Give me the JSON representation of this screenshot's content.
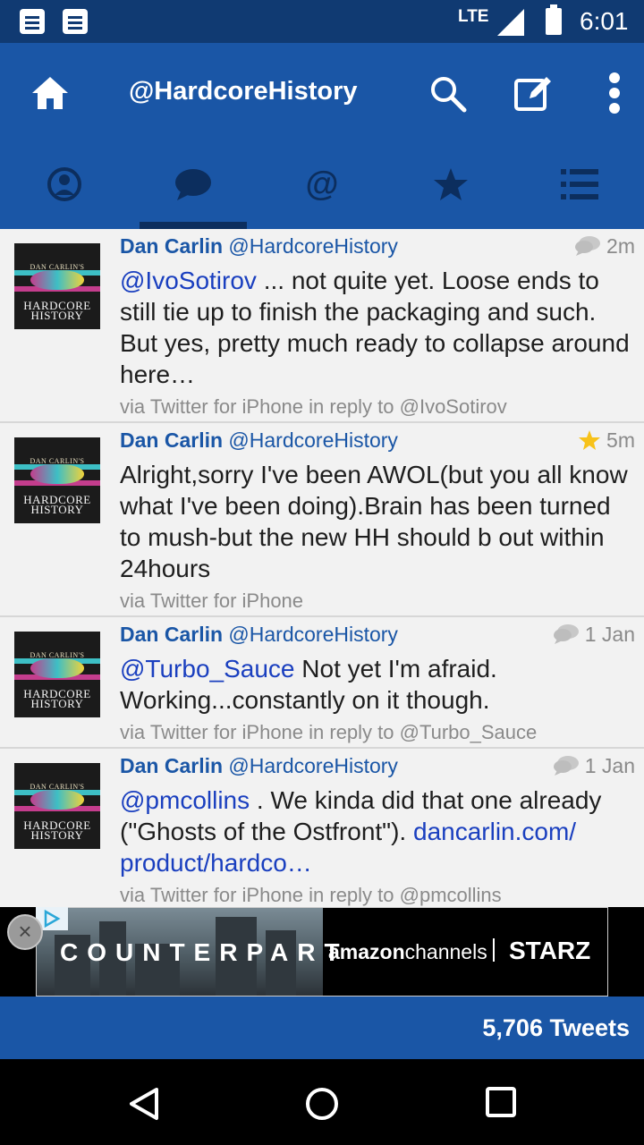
{
  "status_bar": {
    "network": "LTE",
    "time": "6:01"
  },
  "app_bar": {
    "title": "@HardcoreHistory"
  },
  "tabs": [
    {
      "icon": "profile-icon"
    },
    {
      "icon": "conversation-icon",
      "selected": true
    },
    {
      "icon": "at-icon"
    },
    {
      "icon": "star-icon"
    },
    {
      "icon": "list-icon"
    }
  ],
  "avatar": {
    "line1": "DAN CARLIN'S",
    "line2": "HARDCORE",
    "line3": "HISTORY"
  },
  "tweets": [
    {
      "name": "Dan Carlin",
      "handle": "@HardcoreHistory",
      "time": "2m",
      "icon": "reply-icon",
      "mention": "@IvoSotirov",
      "text": " ... not quite yet. Loose ends to still tie up to finish the packaging and such. But yes, pretty much ready to collapse around here…",
      "via": "via Twitter for iPhone in reply to @IvoSotirov"
    },
    {
      "name": "Dan Carlin",
      "handle": "@HardcoreHistory",
      "time": "5m",
      "icon": "favorite-star-icon",
      "text": "Alright,sorry I've been AWOL(but you all know what I've been doing).Brain has been turned to mush-but the new HH should b out within 24hours",
      "via": "via Twitter for iPhone"
    },
    {
      "name": "Dan Carlin",
      "handle": "@HardcoreHistory",
      "time": "1 Jan",
      "icon": "reply-icon",
      "mention": "@Turbo_Sauce",
      "text": " Not yet I'm afraid. Working...constantly on it though.",
      "via": "via Twitter for iPhone in reply to @Turbo_Sauce"
    },
    {
      "name": "Dan Carlin",
      "handle": "@HardcoreHistory",
      "time": "1 Jan",
      "icon": "reply-icon",
      "mention": "@pmcollins",
      "text": " . We kinda did that one already (\"Ghosts of the Ostfront\").  ",
      "link": "dancarlin.com/ product/hardco…",
      "via": "via Twitter for iPhone in reply to @pmcollins"
    }
  ],
  "ad": {
    "show": "COUNTERPART",
    "brand_amazon": "amazon",
    "brand_channels": "channels",
    "brand_starz": "STARZ",
    "close": "×"
  },
  "footer": {
    "tweet_count": "5,706 Tweets"
  },
  "colors": {
    "status_bar": "#103a72",
    "app_bar": "#1a56a6",
    "link": "#1a3fbf",
    "timeline_bg": "#f2f2f2"
  }
}
